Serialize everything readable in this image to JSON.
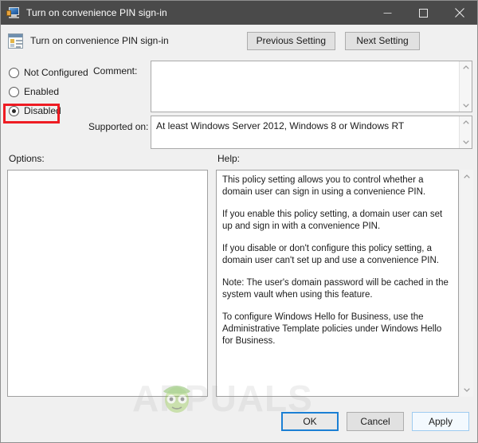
{
  "window": {
    "title": "Turn on convenience PIN sign-in",
    "titlebar_icon": "computer-policy-icon",
    "controls": {
      "minimize": "minimize-icon",
      "maximize": "maximize-icon",
      "close": "close-icon"
    }
  },
  "header": {
    "icon": "policy-setting-icon",
    "title": "Turn on convenience PIN sign-in",
    "previous_setting_label": "Previous Setting",
    "next_setting_label": "Next Setting"
  },
  "state": {
    "options": [
      {
        "label": "Not Configured",
        "selected": false
      },
      {
        "label": "Enabled",
        "selected": false
      },
      {
        "label": "Disabled",
        "selected": true
      }
    ],
    "selected_value": "Disabled",
    "highlight_color": "#ee1c23"
  },
  "comment": {
    "label": "Comment:",
    "value": "",
    "placeholder": ""
  },
  "supported_on": {
    "label": "Supported on:",
    "value": "At least Windows Server 2012, Windows 8 or Windows RT"
  },
  "panes": {
    "options_label": "Options:",
    "help_label": "Help:",
    "options_content": "",
    "help_paragraphs": [
      "This policy setting allows you to control whether a domain user can sign in using a convenience PIN.",
      "If you enable this policy setting, a domain user can set up and sign in with a convenience PIN.",
      "If you disable or don't configure this policy setting, a domain user can't set up and use a convenience PIN.",
      "Note: The user's domain password will be cached in the system vault when using this feature.",
      "To configure Windows Hello for Business, use the Administrative Template policies under Windows Hello for Business."
    ]
  },
  "watermark": {
    "text": "APPUALS",
    "logo": "appuals-mascot-logo"
  },
  "footer": {
    "ok_label": "OK",
    "cancel_label": "Cancel",
    "apply_label": "Apply"
  },
  "scrollbars": {
    "up_arrow": "chevron-up-icon",
    "down_arrow": "chevron-down-icon"
  }
}
